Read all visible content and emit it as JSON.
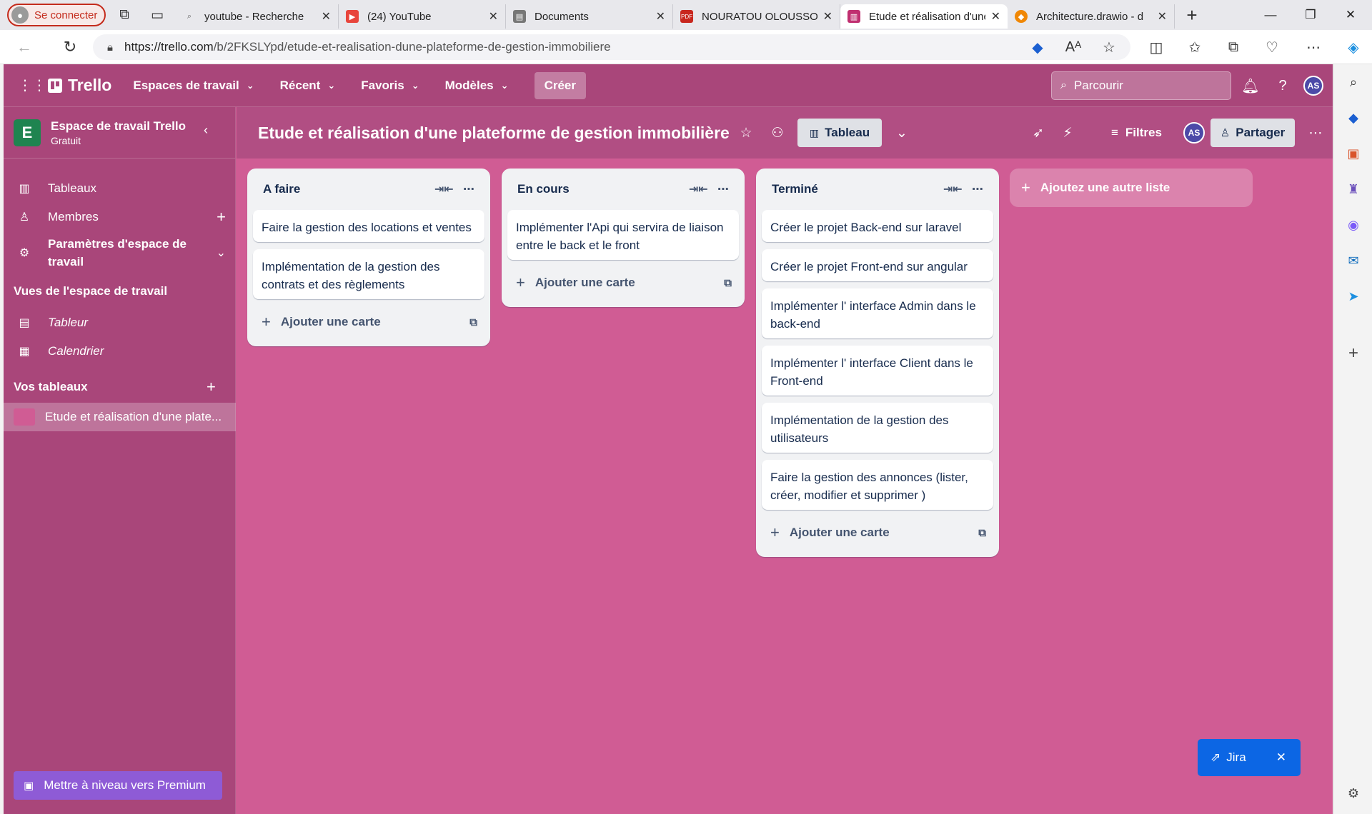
{
  "browser": {
    "profile_label": "Se connecter",
    "tabs": [
      {
        "title": "youtube - Recherche",
        "icon": "search-favicon"
      },
      {
        "title": "(24) YouTube",
        "icon": "youtube-favicon"
      },
      {
        "title": "Documents",
        "icon": "documents-favicon"
      },
      {
        "title": "NOURATOU OLOUSSOU",
        "icon": "pdf-favicon"
      },
      {
        "title": "Etude et réalisation d'une",
        "icon": "trello-favicon"
      },
      {
        "title": "Architecture.drawio - d",
        "icon": "drawio-favicon"
      }
    ],
    "url_host": "https://trello.com",
    "url_path": "/b/2FKSLYpd/etude-et-realisation-dune-plateforme-de-gestion-immobiliere"
  },
  "topnav": {
    "brand": "Trello",
    "menu": [
      "Espaces de travail",
      "Récent",
      "Favoris",
      "Modèles"
    ],
    "create": "Créer",
    "search_placeholder": "Parcourir",
    "avatar_initials": "AS"
  },
  "sidebar": {
    "workspace_initial": "E",
    "workspace_name": "Espace de travail Trello",
    "workspace_plan": "Gratuit",
    "items": [
      {
        "label": "Tableaux",
        "icon": "boards-icon"
      },
      {
        "label": "Membres",
        "icon": "members-icon"
      },
      {
        "label": "Paramètres d'espace de travail",
        "icon": "gear-icon"
      }
    ],
    "views_section": "Vues de l'espace de travail",
    "views": [
      "Tableur",
      "Calendrier"
    ],
    "boards_section": "Vos tableaux",
    "boards": [
      "Etude et réalisation d'une plate..."
    ],
    "premium": "Mettre à niveau vers Premium"
  },
  "board": {
    "title": "Etude et réalisation d'une plateforme de gestion immobilière",
    "view": "Tableau",
    "filters": "Filtres",
    "share": "Partager",
    "avatar_initials": "AS",
    "add_card": "Ajouter une carte",
    "add_list": "Ajoutez une autre liste",
    "lists": [
      {
        "title": "A faire",
        "cards": [
          "Faire la gestion des locations et ventes",
          "Implémentation de la gestion des contrats et des règlements"
        ]
      },
      {
        "title": "En cours",
        "cards": [
          "Implémenter l'Api qui servira de liaison entre le back et le front"
        ]
      },
      {
        "title": "Terminé",
        "cards": [
          "Créer le projet Back-end sur laravel",
          "Créer le projet Front-end sur angular",
          "Implémenter l' interface Admin dans le back-end",
          "Implémenter l' interface Client dans le Front-end",
          "Implémentation de la gestion des utilisateurs",
          "Faire la gestion des annonces (lister, créer, modifier et supprimer )"
        ]
      }
    ]
  },
  "jira": {
    "label": "Jira"
  },
  "colors": {
    "board_bg": "#d05c94",
    "nav_bg": "#a9467a",
    "accent_jira": "#0c66e4",
    "workspace_logo": "#1f8450"
  }
}
